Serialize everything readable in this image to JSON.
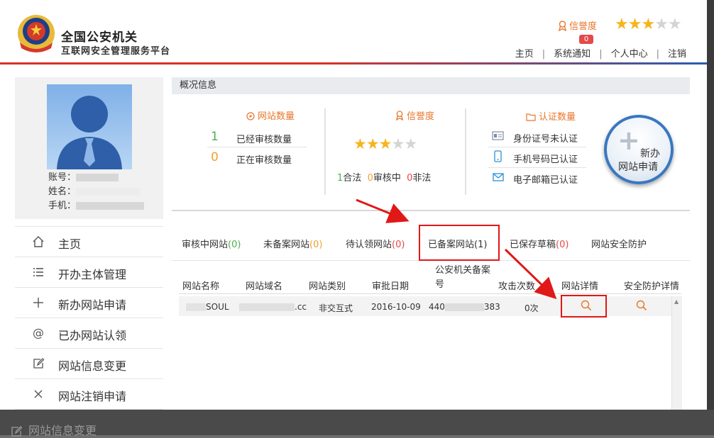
{
  "header": {
    "title": "全国公安机关",
    "subtitle": "互联网安全管理服务平台",
    "credit_label": "信誉度",
    "credit_badge": "0",
    "credit_stars": 3,
    "credit_stars_max": 5,
    "nav": [
      "主页",
      "系统通知",
      "个人中心",
      "注销"
    ]
  },
  "profile": {
    "account_label": "账号：",
    "name_label": "姓名：",
    "phone_label": "手机："
  },
  "sidebar": {
    "items": [
      {
        "label": "主页",
        "icon": "home-icon"
      },
      {
        "label": "开办主体管理",
        "icon": "list-icon"
      },
      {
        "label": "新办网站申请",
        "icon": "plus-icon"
      },
      {
        "label": "已办网站认领",
        "icon": "at-icon"
      },
      {
        "label": "网站信息变更",
        "icon": "edit-icon"
      },
      {
        "label": "网站注销申请",
        "icon": "close-icon"
      }
    ]
  },
  "background_item": "网站信息变更",
  "overview": {
    "heading": "概况信息",
    "site_count": {
      "title": "网站数量",
      "reviewed_num": "1",
      "reviewed_label": "已经审核数量",
      "reviewing_num": "0",
      "reviewing_label": "正在审核数量"
    },
    "credit": {
      "title": "信誉度",
      "stars": 3,
      "stars_max": 5,
      "legal_num": "1",
      "legal_label": "合法",
      "reviewing_num": "0",
      "reviewing_label": "审核中",
      "illegal_num": "0",
      "illegal_label": "非法"
    },
    "certification": {
      "title": "认证数量",
      "id_card": "身份证号未认证",
      "phone": "手机号码已认证",
      "email": "电子邮箱已认证"
    },
    "new_site_button": {
      "line1": "新办",
      "line2": "网站申请"
    }
  },
  "tabs": [
    {
      "label": "审核中网站",
      "count": "(0)",
      "color": "#4caf50"
    },
    {
      "label": "未备案网站",
      "count": "(0)",
      "color": "#f0a030"
    },
    {
      "label": "待认领网站",
      "count": "(0)",
      "color": "#e04848"
    },
    {
      "label": "已备案网站",
      "count": "(1)",
      "color": "#333333"
    },
    {
      "label": "已保存草稿",
      "count": "(0)",
      "color": "#e04848"
    },
    {
      "label": "网站安全防护",
      "count": "",
      "color": "#333333"
    }
  ],
  "table": {
    "columns": [
      "网站名称",
      "网站域名",
      "网站类别",
      "审批日期",
      "公安机关备案号",
      "攻击次数",
      "网站详情",
      "安全防护详情"
    ],
    "rows": [
      {
        "name": "SOUL",
        "domain": ".cc",
        "category": "非交互式",
        "date": "2016-10-09",
        "record_prefix": "440",
        "record_suffix": "383",
        "attacks": "0次"
      }
    ]
  },
  "colors": {
    "accent": "#e8762b",
    "highlight": "#e01818",
    "brand_blue": "#2a5db0",
    "brand_red": "#d8312a"
  }
}
